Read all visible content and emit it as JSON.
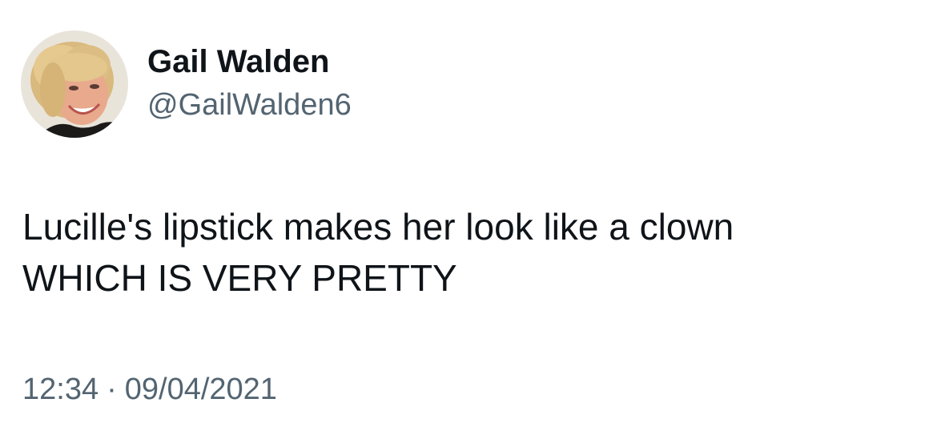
{
  "author": {
    "display_name": "Gail Walden",
    "handle": "@GailWalden6",
    "avatar_icon": "profile-photo"
  },
  "tweet": {
    "lines": [
      "Lucille's lipstick makes her look like a clown",
      "WHICH IS VERY PRETTY"
    ]
  },
  "meta": {
    "time": "12:34",
    "separator": "·",
    "date": "09/04/2021"
  },
  "colors": {
    "primary_text": "#0f1419",
    "secondary_text": "#536471",
    "background": "#ffffff"
  }
}
